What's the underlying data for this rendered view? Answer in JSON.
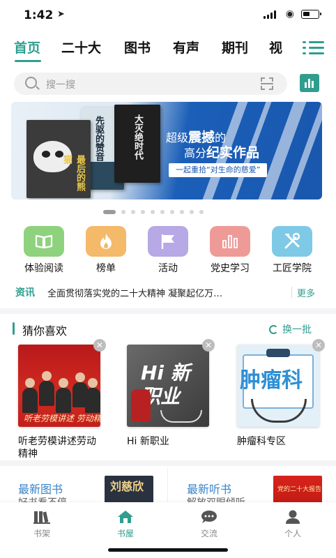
{
  "status": {
    "time": "1:42"
  },
  "tabs": {
    "items": [
      {
        "label": "首页"
      },
      {
        "label": "二十大"
      },
      {
        "label": "图书"
      },
      {
        "label": "有声"
      },
      {
        "label": "期刊"
      },
      {
        "label": "视"
      }
    ]
  },
  "search": {
    "placeholder": "搜一搜"
  },
  "banner": {
    "book1_title": "最后的熊猫",
    "book2_title": "先驱的赞音",
    "book3_title": "大灭绝时代",
    "headline_pre": "超级",
    "headline_em": "震撼",
    "headline_post": "的",
    "headline2_pre": "高分",
    "headline2_em": "纪实作品",
    "tagline": "一起重拾“对生命的慈爱”"
  },
  "carousel": {
    "count": 10,
    "active_index": 0
  },
  "quick": [
    {
      "label": "体验阅读",
      "icon": "book-open-icon",
      "color": "#8ed27e"
    },
    {
      "label": "榜单",
      "icon": "flame-icon",
      "color": "#f5b96a"
    },
    {
      "label": "活动",
      "icon": "flag-icon",
      "color": "#b7a8e6"
    },
    {
      "label": "党史学习",
      "icon": "bar-chart-icon",
      "color": "#ee9b98"
    },
    {
      "label": "工匠学院",
      "icon": "tools-icon",
      "color": "#7ec9e6"
    }
  ],
  "news": {
    "label": "资讯",
    "text": "全面贯彻落实党的二十大精神 凝聚起亿万…",
    "more": "更多"
  },
  "guess": {
    "title": "猜你喜欢",
    "refresh": "换一批",
    "items": [
      {
        "name": "听老劳模讲述劳动精神",
        "cover_text": "听老劳模讲述 劳动精神"
      },
      {
        "name": "Hi 新职业",
        "cover_text": "Hi 新职业"
      },
      {
        "name": "肿瘤科专区",
        "cover_text": "肿瘤科"
      }
    ]
  },
  "promos": [
    {
      "title": "最新图书",
      "subtitle": "好书看不停",
      "thumb_text": "刘慈欣"
    },
    {
      "title": "最新听书",
      "subtitle": "解放双眼倾听",
      "thumb_text": "党的二十大报告"
    }
  ],
  "tabbar": [
    {
      "label": "书架",
      "icon": "bookshelf-icon"
    },
    {
      "label": "书屋",
      "icon": "home-icon"
    },
    {
      "label": "交流",
      "icon": "chat-icon"
    },
    {
      "label": "个人",
      "icon": "person-icon"
    }
  ],
  "colors": {
    "accent": "#2f9e8f",
    "link_blue": "#3a84c8"
  }
}
